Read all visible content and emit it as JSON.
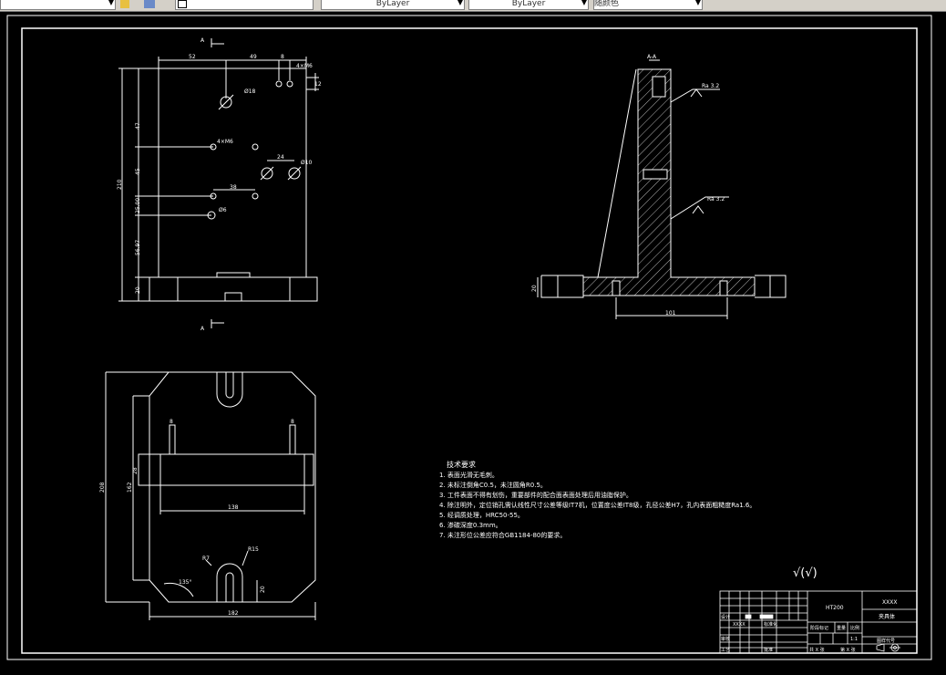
{
  "toolbar": {
    "layer_value": "",
    "color_value": "ByLayer",
    "linetype_value": "ByLayer",
    "plotstyle_value": "随颜色"
  },
  "drawing": {
    "section_label_a": "A",
    "section_label_aa": "A-A",
    "dims_front": {
      "d52": "52",
      "d49": "49",
      "d8": "8",
      "d4xm6_top": "4×M6",
      "d12": "12",
      "d18": "Ø18",
      "d47": "47",
      "d4xm6_mid": "4×M6",
      "d210": "210",
      "d45": "45",
      "d24": "24",
      "d10": "Ø10",
      "d38": "38",
      "d2500": "25.00",
      "d6": "Ø6",
      "d5697": "56.97",
      "d20": "20"
    },
    "dims_section": {
      "ra_top": "Ra 3.2",
      "ra_mid": "Ra 3.2",
      "d20": "20",
      "d101": "101"
    },
    "dims_plan": {
      "d8l": "8",
      "d8r": "8",
      "d28": "28",
      "d162": "162",
      "d208": "208",
      "d138": "138",
      "r7": "R7",
      "r15": "R15",
      "d135": "135°",
      "d20": "20",
      "d182": "182"
    }
  },
  "notes": {
    "title": "技术要求",
    "items": [
      "1. 表面光滑无毛刺。",
      "2. 未标注倒角C0.5，未注圆角R0.5。",
      "3. 工件表面不得有划伤，重要部件的配合面表面处理后用油脂保护。",
      "4. 除注明外，定位销孔需认线性尺寸公差等级IT7机，位置度公差IT8级，孔径公差H7，孔内表面粗糙度Ra1.6。",
      "5. 经调质处理，HRC50-55。",
      "6. 渗碳深度0.3mm。",
      "7. 未注形位公差应符合GB1184-80的要求。"
    ],
    "roughness_symbol": "√(√)"
  },
  "titleblock": {
    "material": "HT200",
    "part_name": "XXXX",
    "drawing_name": "夹具体",
    "designer_label": "设计",
    "designer": "XXXX",
    "check_label": "审核",
    "process_label": "工艺",
    "approve_label": "批准",
    "standard_label": "标准化",
    "stage_label": "阶段标记",
    "weight_label": "重量",
    "scale_label": "比例",
    "scale": "1:1",
    "sheet_total": "共 X 张",
    "sheet_no": "第 X 张",
    "projection_label": "图样代号"
  }
}
